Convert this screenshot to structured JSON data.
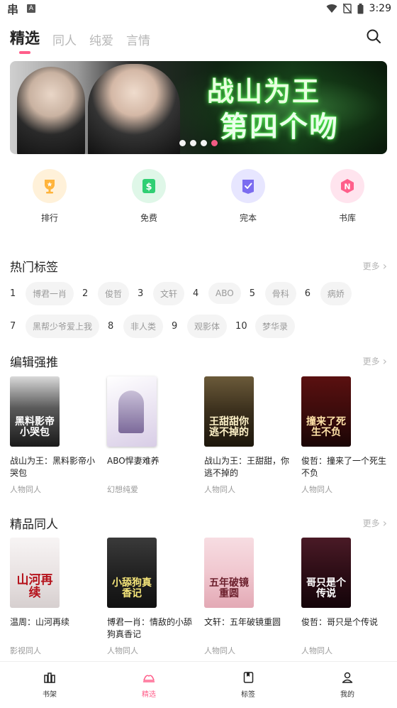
{
  "status_bar": {
    "time": "3:29",
    "box_letter": "A"
  },
  "top_tabs": [
    {
      "label": "精选",
      "active": true
    },
    {
      "label": "同人",
      "active": false
    },
    {
      "label": "纯爱",
      "active": false
    },
    {
      "label": "言情",
      "active": false
    }
  ],
  "banner": {
    "title_line1": "战山为王",
    "title_line2": "第四个吻",
    "dots": 4,
    "active_dot": 4
  },
  "categories": [
    {
      "label": "排行",
      "icon": "trophy-icon",
      "bg": "#fff1d9",
      "fg": "#ffb43b"
    },
    {
      "label": "免费",
      "icon": "free-tag-icon",
      "bg": "#dff7e8",
      "fg": "#2fcf73"
    },
    {
      "label": "完本",
      "icon": "check-badge-icon",
      "bg": "#e7e6ff",
      "fg": "#7b6cf0"
    },
    {
      "label": "书库",
      "icon": "library-icon",
      "bg": "#ffe4ee",
      "fg": "#ff5e8a"
    }
  ],
  "hot_tags": {
    "title": "热门标签",
    "more": "更多",
    "rows": [
      [
        {
          "num": "1",
          "label": "博君一肖"
        },
        {
          "num": "2",
          "label": "俊哲"
        },
        {
          "num": "3",
          "label": "文轩"
        },
        {
          "num": "4",
          "label": "ABO"
        },
        {
          "num": "5",
          "label": "骨科"
        },
        {
          "num": "6",
          "label": "病娇"
        }
      ],
      [
        {
          "num": "7",
          "label": "黑帮少爷爱上我"
        },
        {
          "num": "8",
          "label": "非人类"
        },
        {
          "num": "9",
          "label": "观影体"
        },
        {
          "num": "10",
          "label": "梦华录"
        }
      ]
    ]
  },
  "editor_picks": {
    "title": "编辑强推",
    "more": "更多",
    "books": [
      {
        "title": "战山为王：黑料影帝小哭包",
        "category": "人物同人",
        "cover_text": "黑料影帝小哭包",
        "cover_bg": "#1a1a1a",
        "cover_fg": "#ffffff"
      },
      {
        "title": "ABO悍妻难养",
        "category": "幻想纯爱",
        "cover_text": "",
        "cover_bg": "#f1eef6",
        "cover_fg": "#6a5aa8"
      },
      {
        "title": "战山为王：王甜甜，你逃不掉的",
        "category": "人物同人",
        "cover_text": "王甜甜你逃不掉的",
        "cover_bg": "#2a2418",
        "cover_fg": "#fff3c9"
      },
      {
        "title": "俊哲：撞来了一个死生不负",
        "category": "人物同人",
        "cover_text": "撞来了死生不负",
        "cover_bg": "#3a0b0b",
        "cover_fg": "#ffe2a8"
      }
    ]
  },
  "premium_fanfic": {
    "title": "精品同人",
    "more": "更多",
    "books": [
      {
        "title": "温周：山河再续",
        "category": "影视同人",
        "cover_text": "山河再续",
        "cover_bg": "#f2efef",
        "cover_fg": "#b5121b"
      },
      {
        "title": "博君一肖：情敌的小舔狗真香记",
        "category": "人物同人",
        "cover_text": "小舔狗真香记",
        "cover_bg": "#202020",
        "cover_fg": "#f7e77a"
      },
      {
        "title": "文轩：五年破镜重圆",
        "category": "人物同人",
        "cover_text": "五年破镜重圆",
        "cover_bg": "#f0c7cf",
        "cover_fg": "#6b1f2c"
      },
      {
        "title": "俊哲：哥只是个传说",
        "category": "人物同人",
        "cover_text": "哥只是个传说",
        "cover_bg": "#2a0c14",
        "cover_fg": "#ffffff"
      }
    ]
  },
  "bottom_nav": [
    {
      "label": "书架",
      "icon": "bookshelf-icon",
      "active": false
    },
    {
      "label": "精选",
      "icon": "featured-icon",
      "active": true
    },
    {
      "label": "标签",
      "icon": "tag-icon",
      "active": false
    },
    {
      "label": "我的",
      "icon": "profile-icon",
      "active": false
    }
  ]
}
